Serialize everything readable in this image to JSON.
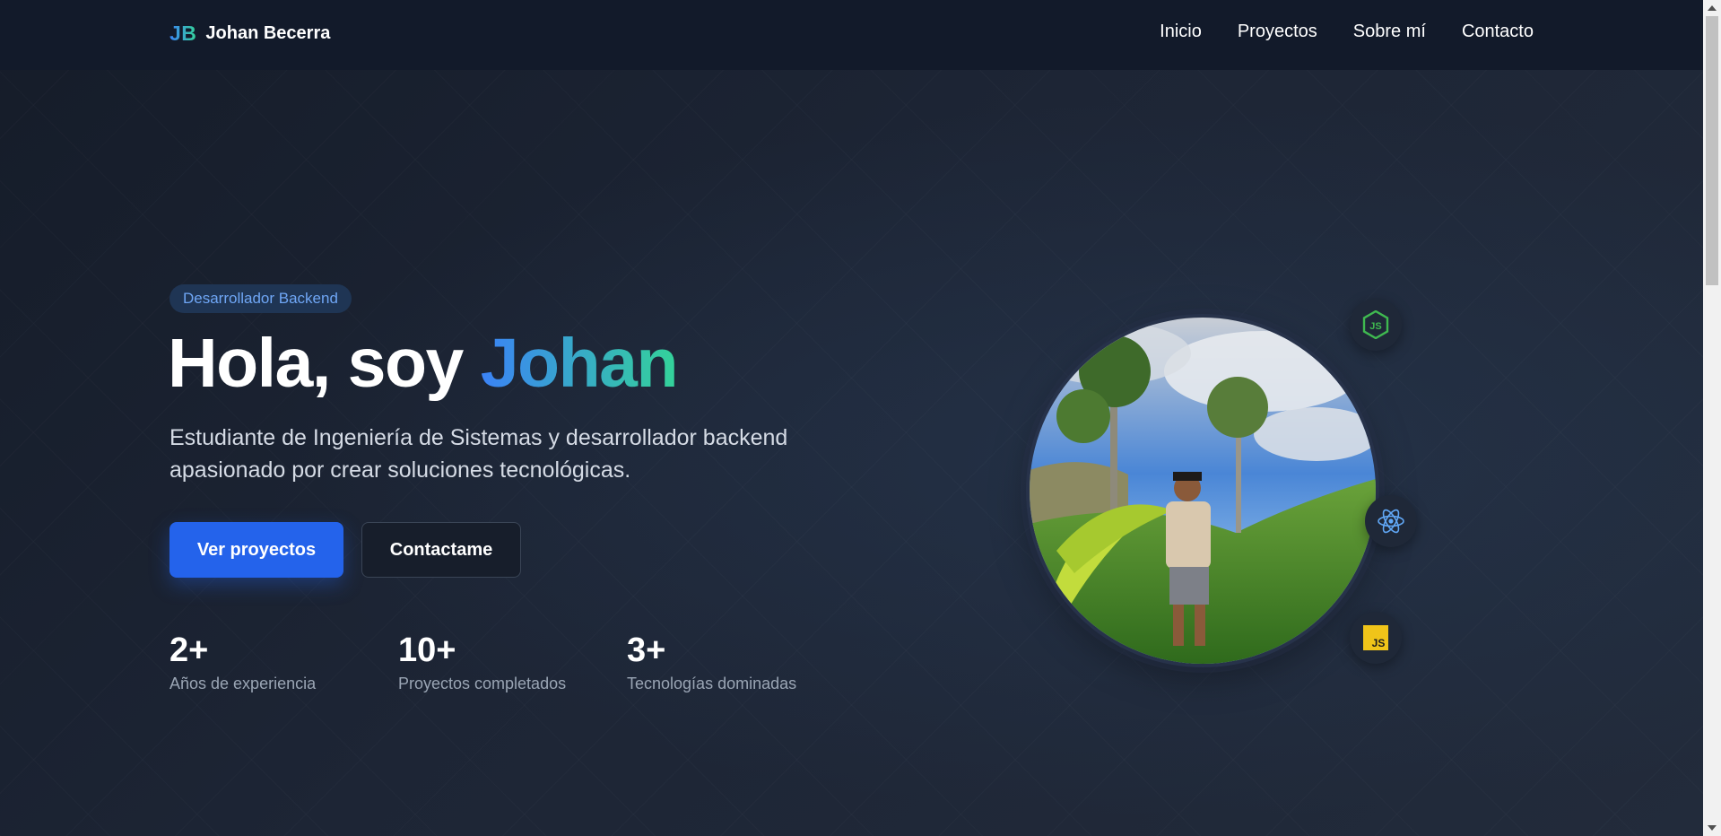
{
  "header": {
    "logo_mark": "JB",
    "logo_name": "Johan Becerra",
    "nav": [
      "Inicio",
      "Proyectos",
      "Sobre mí",
      "Contacto"
    ]
  },
  "hero": {
    "badge": "Desarrollador Backend",
    "title_prefix": "Hola, soy ",
    "title_name": "Johan",
    "description": "Estudiante de Ingeniería de Sistemas y desarrollador backend apasionado por crear soluciones tecnológicas.",
    "primary_button": "Ver proyectos",
    "secondary_button": "Contactame",
    "stats": [
      {
        "value": "2+",
        "label": "Años de experiencia"
      },
      {
        "value": "10+",
        "label": "Proyectos completados"
      },
      {
        "value": "3+",
        "label": "Tecnologías dominadas"
      }
    ]
  },
  "tech_icons": {
    "node": "JS",
    "javascript": "JS"
  },
  "colors": {
    "accent_blue": "#2463eb",
    "gradient_start": "#3b82f6",
    "gradient_end": "#34d399",
    "background": "#1b2331",
    "header": "#121a2a"
  }
}
